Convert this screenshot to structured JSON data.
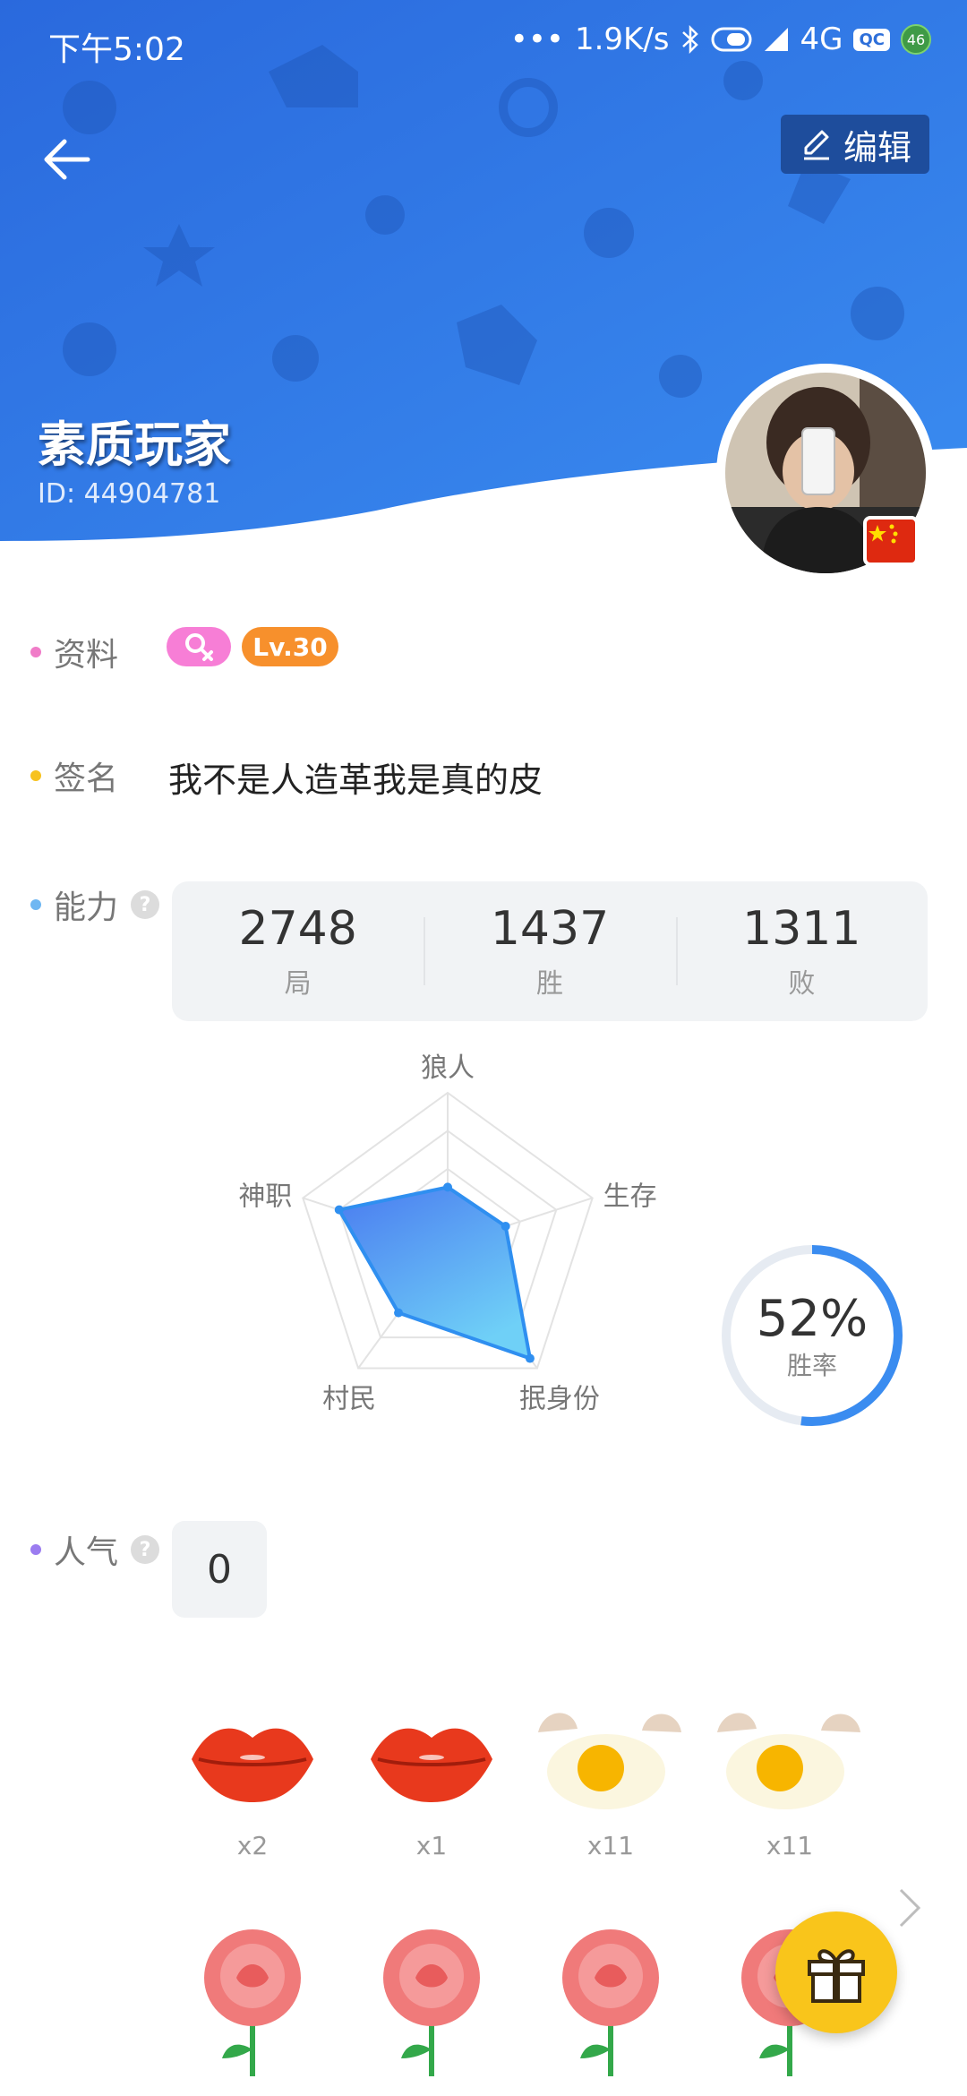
{
  "status_bar": {
    "time": "下午5:02",
    "network_speed": "1.9K/s",
    "network_type": "4G",
    "qc_label": "QC",
    "battery_level": "46"
  },
  "header": {
    "edit_label": "编辑",
    "nickname": "素质玩家",
    "user_id": "ID: 44904781",
    "accent_color": "#2f7ee8"
  },
  "profile": {
    "info_label": "资料",
    "level_badge": "Lv.30",
    "signature_label": "签名",
    "signature": "我不是人造革我是真的皮",
    "ability_label": "能力",
    "popularity_label": "人气",
    "popularity_value": "0"
  },
  "stats": [
    {
      "value": "2748",
      "label": "局"
    },
    {
      "value": "1437",
      "label": "胜"
    },
    {
      "value": "1311",
      "label": "败"
    }
  ],
  "radar": {
    "axes": [
      "狼人",
      "生存",
      "抿身份",
      "村民",
      "神职"
    ],
    "values": [
      0.38,
      0.4,
      0.92,
      0.55,
      0.75
    ],
    "fill_color": "#4d8ff0"
  },
  "winrate": {
    "value": "52%",
    "label": "胜率",
    "fraction": 0.52
  },
  "gifts": [
    {
      "icon": "lips-icon",
      "count": "x2"
    },
    {
      "icon": "lips-icon",
      "count": "x1"
    },
    {
      "icon": "egg-icon",
      "count": "x11"
    },
    {
      "icon": "egg-icon",
      "count": "x11"
    },
    {
      "icon": "rose-icon",
      "count": ""
    },
    {
      "icon": "rose-icon",
      "count": ""
    },
    {
      "icon": "rose-icon",
      "count": ""
    },
    {
      "icon": "rose-icon",
      "count": ""
    }
  ]
}
